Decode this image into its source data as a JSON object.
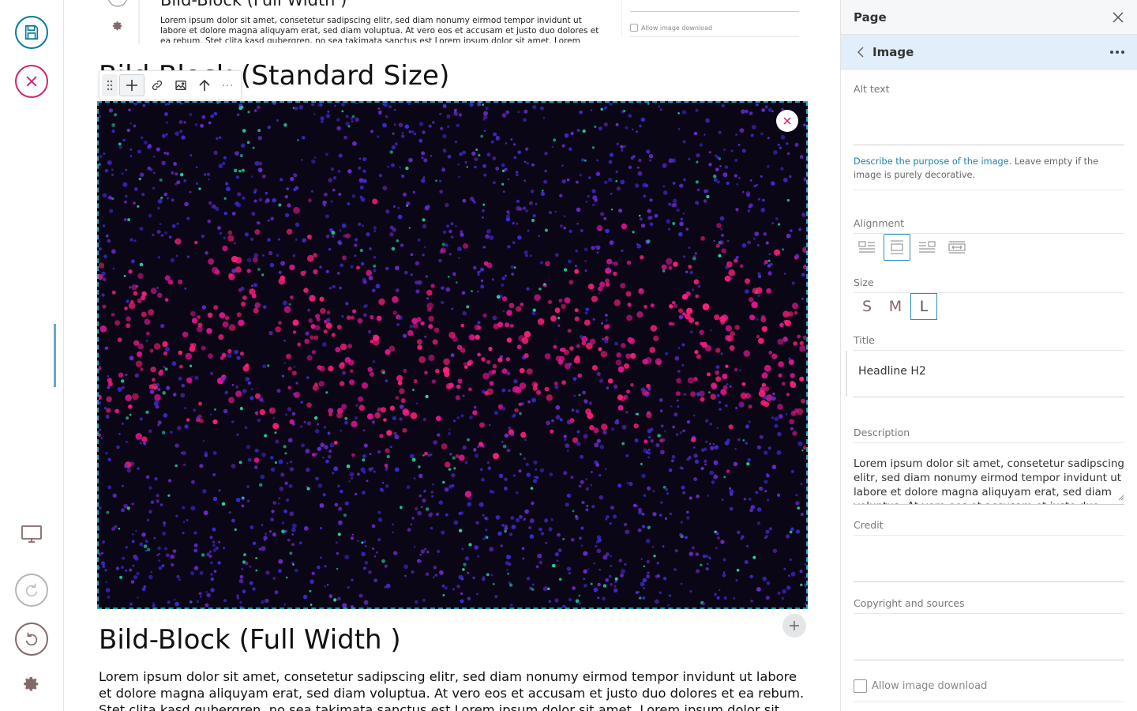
{
  "toolbar_left": {
    "save": "save-icon",
    "cancel": "close-circle-icon",
    "preview": "desktop-icon",
    "redo": "redo-icon",
    "undo": "undo-icon",
    "settings": "gear-icon"
  },
  "previous_block": {
    "title": "Bild-Block (Full Width )",
    "text": "Lorem ipsum dolor sit amet, consetetur sadipscing elitr, sed diam nonumy eirmod tempor invidunt ut labore et dolore magna aliquyam erat, sed diam voluptua. At vero eos et accusam et justo duo dolores et ea rebum. Stet clita kasd gubergren, no sea takimata sanctus est Lorem ipsum dolor sit amet. Lorem ipsum dolor sit amet.",
    "allow_download": "Allow image download"
  },
  "current_block": {
    "heading": "Bild-Block (Standard Size)"
  },
  "next_block": {
    "title": "Bild-Block (Full Width )",
    "text": "Lorem ipsum dolor sit amet, consetetur sadipscing elitr, sed diam nonumy eirmod tempor invidunt ut labore et dolore magna aliquyam erat, sed diam voluptua. At vero eos et accusam et justo duo dolores et ea rebum. Stet clita kasd gubergren, no sea takimata sanctus est Lorem ipsum dolor sit amet. Lorem ipsum dolor sit amet."
  },
  "sidebar": {
    "header_title": "Page",
    "sub_title": "Image",
    "alt_text_label": "Alt text",
    "alt_text_value": "",
    "hint_link": "Describe the purpose of the image.",
    "hint_rest": " Leave empty if the image is purely decorative.",
    "alignment_label": "Alignment",
    "size_label": "Size",
    "sizes": [
      "S",
      "M",
      "L"
    ],
    "selected_size": "L",
    "title_label": "Title",
    "title_value": "Headline H2",
    "description_label": "Description",
    "description_value": "Lorem ipsum dolor sit amet, consetetur sadipscing elitr, sed diam nonumy eirmod tempor invidunt ut labore et dolore magna aliquyam erat, sed diam voluptua. At vero eos et accusam et justo duo dolores et ea rebum.",
    "credit_label": "Credit",
    "copyright_label": "Copyright and sources",
    "allow_download": "Allow image download"
  },
  "colors": {
    "accent": "#0a7a9a",
    "cancel": "#d2236d",
    "selection": "#2a9ec7"
  }
}
